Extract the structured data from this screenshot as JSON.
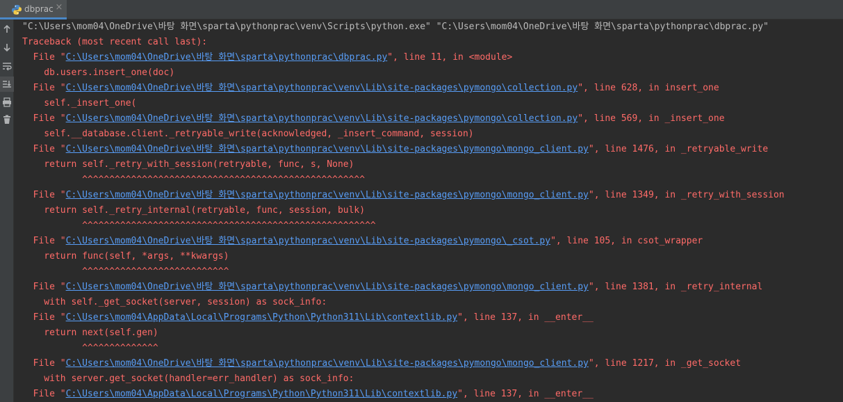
{
  "tab": {
    "label": "dbprac",
    "close_glyph": "×",
    "icon": "python-file-icon"
  },
  "sidebar": {
    "buttons": [
      {
        "icon": "scroll-up-arrow-icon"
      },
      {
        "icon": "scroll-down-arrow-icon"
      },
      {
        "icon": "soft-wrap-icon"
      },
      {
        "icon": "scroll-to-end-icon"
      },
      {
        "icon": "print-icon"
      },
      {
        "icon": "trash-icon"
      }
    ]
  },
  "colors": {
    "error_text": "#ff6b68",
    "link": "#589df6",
    "command_text": "#bbbbbb",
    "background": "#2b2b2b"
  },
  "console": {
    "command": "\"C:\\Users\\mom04\\OneDrive\\바탕 화면\\sparta\\pythonprac\\venv\\Scripts\\python.exe\" \"C:\\Users\\mom04\\OneDrive\\바탕 화면\\sparta\\pythonprac\\dbprac.py\"",
    "traceback_header": "Traceback (most recent call last):",
    "lines": [
      {
        "kind": "file",
        "pre": "  File \"",
        "path": "C:\\Users\\mom04\\OneDrive\\바탕 화면\\sparta\\pythonprac\\dbprac.py",
        "post": "\", line 11, in <module>"
      },
      {
        "kind": "code",
        "text": "    db.users.insert_one(doc)"
      },
      {
        "kind": "file",
        "pre": "  File \"",
        "path": "C:\\Users\\mom04\\OneDrive\\바탕 화면\\sparta\\pythonprac\\venv\\Lib\\site-packages\\pymongo\\collection.py",
        "post": "\", line 628, in insert_one"
      },
      {
        "kind": "code",
        "text": "    self._insert_one("
      },
      {
        "kind": "file",
        "pre": "  File \"",
        "path": "C:\\Users\\mom04\\OneDrive\\바탕 화면\\sparta\\pythonprac\\venv\\Lib\\site-packages\\pymongo\\collection.py",
        "post": "\", line 569, in _insert_one"
      },
      {
        "kind": "code",
        "text": "    self.__database.client._retryable_write(acknowledged, _insert_command, session)"
      },
      {
        "kind": "file",
        "pre": "  File \"",
        "path": "C:\\Users\\mom04\\OneDrive\\바탕 화면\\sparta\\pythonprac\\venv\\Lib\\site-packages\\pymongo\\mongo_client.py",
        "post": "\", line 1476, in _retryable_write"
      },
      {
        "kind": "code",
        "text": "    return self._retry_with_session(retryable, func, s, None)"
      },
      {
        "kind": "caret",
        "text": "           ^^^^^^^^^^^^^^^^^^^^^^^^^^^^^^^^^^^^^^^^^^^^^^^^^^^^"
      },
      {
        "kind": "file",
        "pre": "  File \"",
        "path": "C:\\Users\\mom04\\OneDrive\\바탕 화면\\sparta\\pythonprac\\venv\\Lib\\site-packages\\pymongo\\mongo_client.py",
        "post": "\", line 1349, in _retry_with_session"
      },
      {
        "kind": "code",
        "text": "    return self._retry_internal(retryable, func, session, bulk)"
      },
      {
        "kind": "caret",
        "text": "           ^^^^^^^^^^^^^^^^^^^^^^^^^^^^^^^^^^^^^^^^^^^^^^^^^^^^^^"
      },
      {
        "kind": "file",
        "pre": "  File \"",
        "path": "C:\\Users\\mom04\\OneDrive\\바탕 화면\\sparta\\pythonprac\\venv\\Lib\\site-packages\\pymongo\\_csot.py",
        "post": "\", line 105, in csot_wrapper"
      },
      {
        "kind": "code",
        "text": "    return func(self, *args, **kwargs)"
      },
      {
        "kind": "caret",
        "text": "           ^^^^^^^^^^^^^^^^^^^^^^^^^^^"
      },
      {
        "kind": "file",
        "pre": "  File \"",
        "path": "C:\\Users\\mom04\\OneDrive\\바탕 화면\\sparta\\pythonprac\\venv\\Lib\\site-packages\\pymongo\\mongo_client.py",
        "post": "\", line 1381, in _retry_internal"
      },
      {
        "kind": "code",
        "text": "    with self._get_socket(server, session) as sock_info:"
      },
      {
        "kind": "file",
        "pre": "  File \"",
        "path": "C:\\Users\\mom04\\AppData\\Local\\Programs\\Python\\Python311\\Lib\\contextlib.py",
        "post": "\", line 137, in __enter__"
      },
      {
        "kind": "code",
        "text": "    return next(self.gen)"
      },
      {
        "kind": "caret",
        "text": "           ^^^^^^^^^^^^^^"
      },
      {
        "kind": "file",
        "pre": "  File \"",
        "path": "C:\\Users\\mom04\\OneDrive\\바탕 화면\\sparta\\pythonprac\\venv\\Lib\\site-packages\\pymongo\\mongo_client.py",
        "post": "\", line 1217, in _get_socket"
      },
      {
        "kind": "code",
        "text": "    with server.get_socket(handler=err_handler) as sock_info:"
      },
      {
        "kind": "file",
        "pre": "  File \"",
        "path": "C:\\Users\\mom04\\AppData\\Local\\Programs\\Python\\Python311\\Lib\\contextlib.py",
        "post": "\", line 137, in __enter__"
      }
    ]
  }
}
